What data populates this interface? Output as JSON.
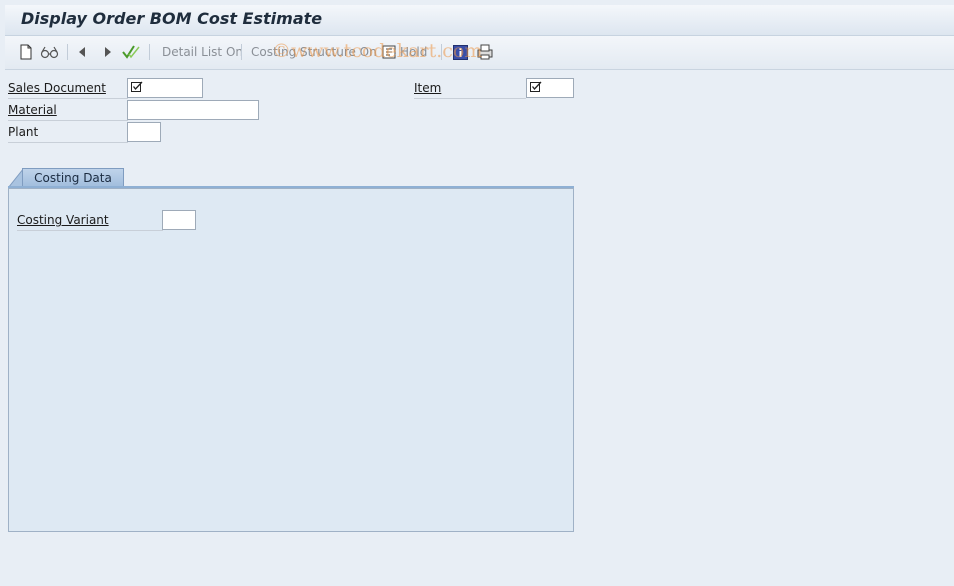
{
  "window": {
    "title": "Display Order BOM Cost Estimate"
  },
  "toolbar": {
    "new_icon": "new-document-icon",
    "glasses_icon": "display-glasses-icon",
    "prev_icon": "previous-arrow-icon",
    "next_icon": "next-arrow-icon",
    "check_icon": "check-icon",
    "detail_list_label": "Detail List On",
    "costing_structure_label": "Costing Structure On",
    "hold_label": "Hold",
    "info_icon": "information-icon",
    "print_icon": "print-icon"
  },
  "watermark": "©www.tcodekart.com",
  "selection": {
    "sales_document_label": "Sales Document",
    "sales_document_value": "",
    "item_label": "Item",
    "item_value": "",
    "material_label": "Material",
    "material_value": "",
    "plant_label": "Plant",
    "plant_value": ""
  },
  "tabs": [
    {
      "label": "Costing Data",
      "active": true
    }
  ],
  "costing_data": {
    "costing_variant_label": "Costing Variant",
    "costing_variant_value": ""
  },
  "colors": {
    "title_bg": "#e4ebf3",
    "tab_active": "#a9c3e0",
    "panel_bg": "#dee9f3",
    "watermark": "#ec9646"
  }
}
